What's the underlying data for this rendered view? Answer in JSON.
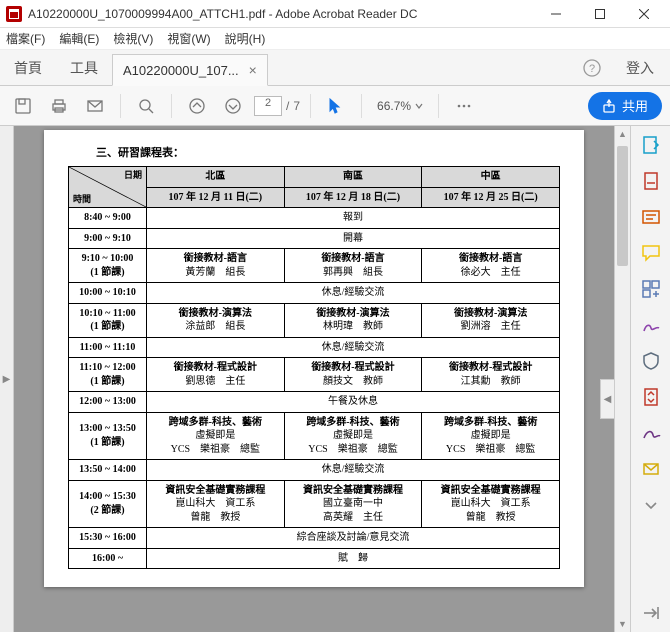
{
  "window": {
    "title": "A10220000U_1070009994A00_ATTCH1.pdf - Adobe Acrobat Reader DC"
  },
  "menu": {
    "file": "檔案(F)",
    "edit": "編輯(E)",
    "view": "檢視(V)",
    "window": "視窗(W)",
    "help": "說明(H)"
  },
  "nav": {
    "home": "首頁",
    "tools": "工具"
  },
  "tab": {
    "label": "A10220000U_107...",
    "close": "×"
  },
  "header": {
    "help": "?",
    "signin": "登入"
  },
  "toolbar": {
    "pagecur": "2",
    "pagesep": "/",
    "pagetotal": "7",
    "zoom": "66.7%",
    "share": "共用"
  },
  "doc": {
    "caption": "三、研習課程表：",
    "head_diag_top": "日期",
    "head_diag_bottom": "時間",
    "regions": {
      "north": "北區",
      "south": "南區",
      "central": "中區"
    },
    "dates": {
      "north": "107 年 12 月 11 日(二)",
      "south": "107 年 12 月 18 日(二)",
      "central": "107 年 12 月 25 日(二)"
    },
    "rows": [
      {
        "time": "8:40 ~ 9:00",
        "type": "span",
        "text": "報到"
      },
      {
        "time": "9:00 ~ 9:10",
        "type": "span",
        "text": "開幕"
      },
      {
        "time": "9:10 ~ 10:00",
        "sub": "(1 節課)",
        "type": "cols",
        "n": "銜接教材-語言\n黃芳蘭　組長",
        "s": "銜接教材-語言\n郭再興　組長",
        "c": "銜接教材-語言\n徐必大　主任"
      },
      {
        "time": "10:00 ~ 10:10",
        "type": "span",
        "text": "休息/經驗交流"
      },
      {
        "time": "10:10 ~ 11:00",
        "sub": "(1 節課)",
        "type": "cols",
        "n": "銜接教材-演算法\n涂益郎　組長",
        "s": "銜接教材-演算法\n林明瑋　教師",
        "c": "銜接教材-演算法\n劉洲溶　主任"
      },
      {
        "time": "11:00 ~ 11:10",
        "type": "span",
        "text": "休息/經驗交流"
      },
      {
        "time": "11:10 ~ 12:00",
        "sub": "(1 節課)",
        "type": "cols",
        "n": "銜接教材-程式設計\n劉思德　主任",
        "s": "銜接教材-程式設計\n顏技文　教師",
        "c": "銜接教材-程式設計\n江其勳　教師"
      },
      {
        "time": "12:00 ~ 13:00",
        "type": "span",
        "text": "午餐及休息"
      },
      {
        "time": "13:00 ~ 13:50",
        "sub": "(1 節課)",
        "type": "cols",
        "n": "跨域多群-科技、藝術\n虛擬即是\nYCS　樂祖豪　總監",
        "s": "跨域多群-科技、藝術\n虛擬即是\nYCS　樂祖豪　總監",
        "c": "跨域多群-科技、藝術\n虛擬即是\nYCS　樂祖豪　總監"
      },
      {
        "time": "13:50 ~ 14:00",
        "type": "span",
        "text": "休息/經驗交流"
      },
      {
        "time": "14:00 ~ 15:30",
        "sub": "(2 節課)",
        "type": "cols",
        "n": "資訊安全基礎實務課程\n崑山科大　資工系\n曾龍　教授",
        "s": "資訊安全基礎實務課程\n國立臺南一中\n高英耀　主任",
        "c": "資訊安全基礎實務課程\n崑山科大　資工系\n曾龍　教授"
      },
      {
        "time": "15:30 ~ 16:00",
        "type": "span",
        "text": "綜合座談及討論/意見交流"
      },
      {
        "time": "16:00 ~",
        "type": "span",
        "text": "賦　歸"
      }
    ]
  }
}
